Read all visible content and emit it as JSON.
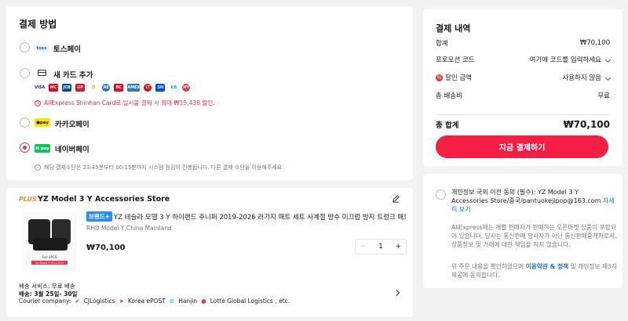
{
  "payment": {
    "title": "결제 방법",
    "options": {
      "toss": {
        "badge": "toss",
        "label": "토스페이"
      },
      "card": {
        "label": "새 카드 추가",
        "brands": [
          "VISA",
          "MC",
          "JCB",
          "UP",
          "D",
          "AE",
          "BC",
          "AMEX",
          "LT",
          "SH",
          "KB",
          "HY"
        ],
        "promo": "AliExpress Shinhan Card로 일시불 결제 시 최대 ₩15,438 할인."
      },
      "kakao": {
        "badge": "●pay",
        "label": "카카오페이"
      },
      "naver": {
        "badge": "N pay",
        "label": "네이버페이",
        "notice": "해당 결제수단은 23:45분부터 00:15분까지 시스템 점검이 진행됩니다. 다른 결제 수단을 이용해주세요."
      }
    }
  },
  "store": {
    "plus_badge": "PLUS",
    "name": "YZ Model 3 Y Accessories Store",
    "item": {
      "badge": "브랜드+",
      "title": "YZ 테슬라 모델 3 Y 하이랜드 주니퍼 2019-2026 러기지 매트 세트 사계절 방수 미끄럼 방지 트렁크 매트",
      "variant": "RHD Model Y,China Mainland",
      "price": "₩70,100",
      "quantity": "1",
      "minus": "−",
      "plus": "+",
      "img_caption": "Full 3PCS",
      "img_subcaption": "For Model Y 2021-2025"
    },
    "shipping": {
      "service": "배송 서비스: 무료 배송",
      "delivery": "배송: 3월 25일- 30일",
      "courier_label": "Courier company:",
      "couriers": [
        "CJLogistics",
        "Korea ePOST",
        "Hanjin",
        "Lotte Global Logistics , etc."
      ]
    }
  },
  "summary": {
    "title": "결제 내역",
    "subtotal_label": "합계",
    "subtotal": "₩70,100",
    "promo_label": "프로모션 코드",
    "promo_value": "여기에 코드를 입력하세요",
    "discount_label": "할인 금액",
    "discount_value": "사용하지 않음",
    "shipping_label": "총 배송비",
    "shipping_value": "무료",
    "total_label": "총 합계",
    "total": "₩70,100",
    "pay_button": "지금 결제하기"
  },
  "consent": {
    "title": "개인정보 국외 이전 동의 (필수): YZ Model 3 Y Accessories Store/중국/pantuokejipop@163.com",
    "link": "자세히 보기",
    "desc": "AliExpress에는 개별 판매자가 판매하는 오픈마켓 상품이 포함되어 있습니다. 당사는 통신판매 당사자가 아닌 통신판매중개자로서, 상품정보 및 거래에 대한 책임을 지지 않습니다.",
    "agree_pre": "위 주문 내용을 확인하였으며 ",
    "agree_link": "이용약관 & 정책",
    "agree_post": " 및 개인정보 제3자 제공에 동의합니다."
  },
  "colors": {
    "accent": "#f51f45",
    "radio_selected": "#e8334a",
    "link": "#1a6ed8",
    "plus_badge": "#f58a1f"
  }
}
